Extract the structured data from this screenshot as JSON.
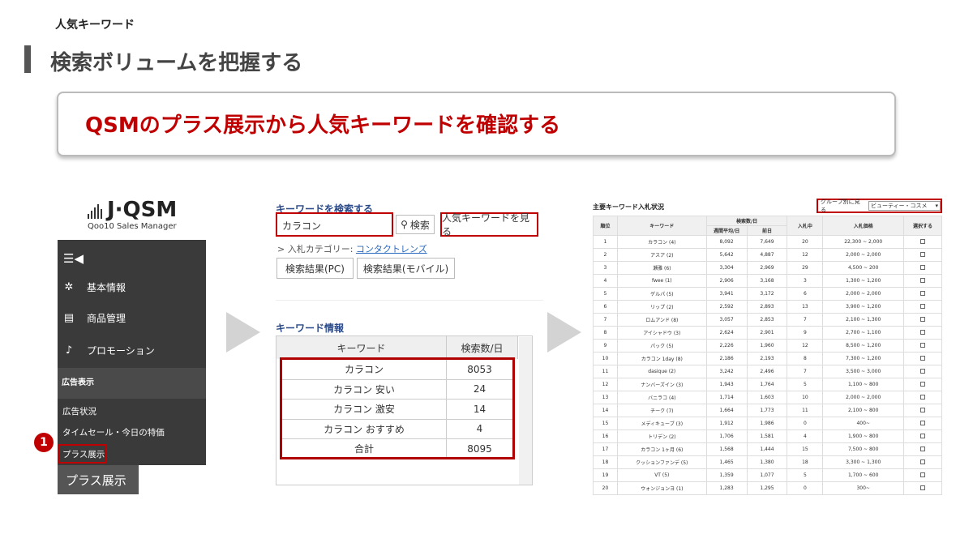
{
  "slide": {
    "label": "人気キーワード",
    "title": "検索ボリュームを把握する",
    "banner": "QSMのプラス展示から人気キーワードを確認する"
  },
  "sidebar": {
    "logo": "J·QSM",
    "logo_sub": "Qoo10 Sales Manager",
    "menu_icon": "☰◀",
    "items": [
      {
        "icon": "gear-icon",
        "label": "基本情報"
      },
      {
        "icon": "document-icon",
        "label": "商品管理"
      },
      {
        "icon": "bell-icon",
        "label": "プロモーション"
      }
    ],
    "section": "広告表示",
    "sub_items": [
      "広告状況",
      "タイムセール・今日の特価",
      "プラス展示"
    ],
    "tooltip": "プラス展示",
    "step_number": "1"
  },
  "middle": {
    "search_title": "キーワードを検索する",
    "search_value": "カラコン",
    "search_button": "検索",
    "popular_button": "人気キーワードを見る",
    "category_label": "入札カテゴリー: ",
    "category_link": "コンタクトレンズ",
    "tab_pc": "検索結果(PC)",
    "tab_mobile": "検索結果(モバイル)",
    "info_title": "キーワード情報",
    "col_keyword": "キーワード",
    "col_count": "検索数/日",
    "rows": [
      {
        "keyword": "カラコン",
        "count": "8053"
      },
      {
        "keyword": "カラコン 安い",
        "count": "24"
      },
      {
        "keyword": "カラコン 激安",
        "count": "14"
      },
      {
        "keyword": "カラコン おすすめ",
        "count": "4"
      },
      {
        "keyword": "合計",
        "count": "8095"
      }
    ]
  },
  "right": {
    "title": "主要キーワード入札状況",
    "group_label": "グループ別に見る",
    "group_value": "ビューティー・コスメ",
    "headers": {
      "rank": "順位",
      "keyword": "キーワード",
      "search": "検索数/日",
      "weekly": "週間平均/日",
      "prev": "前日",
      "bids": "入札中",
      "price": "入札価格",
      "select": "選択する"
    },
    "rows": [
      [
        "1",
        "カラコン (4)",
        "8,092",
        "7,649",
        "20",
        "22,300 ~ 2,000"
      ],
      [
        "2",
        "アスア (2)",
        "5,642",
        "4,887",
        "12",
        "2,000 ~ 2,000"
      ],
      [
        "3",
        "瀬雅 (6)",
        "3,304",
        "2,969",
        "29",
        "4,500 ~ 200"
      ],
      [
        "4",
        "fwee (1)",
        "2,906",
        "3,168",
        "3",
        "1,300 ~ 1,200"
      ],
      [
        "5",
        "ゲルパ (5)",
        "3,941",
        "3,172",
        "6",
        "2,000 ~ 2,000"
      ],
      [
        "6",
        "リップ (2)",
        "2,592",
        "2,893",
        "13",
        "3,900 ~ 1,200"
      ],
      [
        "7",
        "ロムアンド (8)",
        "3,057",
        "2,853",
        "7",
        "2,100 ~ 1,300"
      ],
      [
        "8",
        "アイシャドウ (3)",
        "2,624",
        "2,901",
        "9",
        "2,700 ~ 1,100"
      ],
      [
        "9",
        "パック (5)",
        "2,226",
        "1,960",
        "12",
        "8,500 ~ 1,200"
      ],
      [
        "10",
        "カラコン 1day (8)",
        "2,186",
        "2,193",
        "8",
        "7,300 ~ 1,200"
      ],
      [
        "11",
        "dasique (2)",
        "3,242",
        "2,496",
        "7",
        "3,500 ~ 3,000"
      ],
      [
        "12",
        "ナンバーズイン (3)",
        "1,943",
        "1,764",
        "5",
        "1,100 ~ 800"
      ],
      [
        "13",
        "バニラコ (4)",
        "1,714",
        "1,603",
        "10",
        "2,000 ~ 2,000"
      ],
      [
        "14",
        "チーク (7)",
        "1,664",
        "1,773",
        "11",
        "2,100 ~ 800"
      ],
      [
        "15",
        "メディキューブ (3)",
        "1,912",
        "1,986",
        "0",
        "400~"
      ],
      [
        "16",
        "トリデン (2)",
        "1,706",
        "1,581",
        "4",
        "1,900 ~ 800"
      ],
      [
        "17",
        "カラコン 1ヶ月 (6)",
        "1,568",
        "1,444",
        "15",
        "7,500 ~ 800"
      ],
      [
        "18",
        "クッションファンデ (5)",
        "1,465",
        "1,380",
        "18",
        "3,300 ~ 1,300"
      ],
      [
        "19",
        "VT (5)",
        "1,359",
        "1,077",
        "5",
        "1,700 ~ 600"
      ],
      [
        "20",
        "ウォンジョンヨ (1)",
        "1,283",
        "1,295",
        "0",
        "300~"
      ]
    ]
  }
}
